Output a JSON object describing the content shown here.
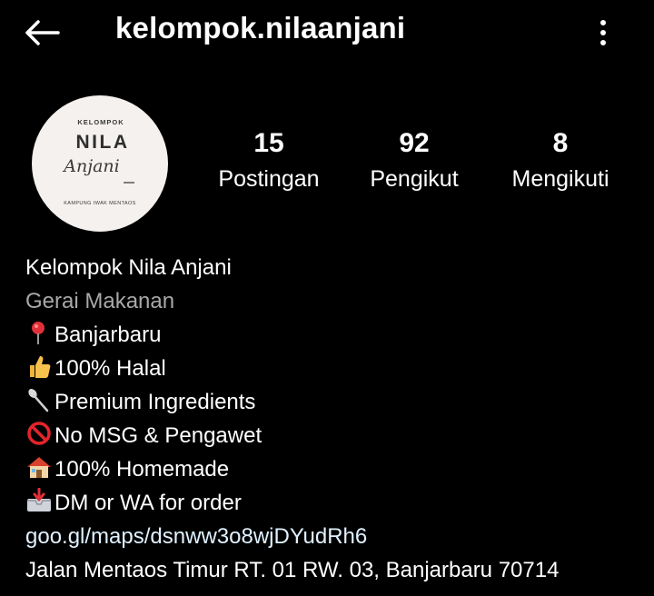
{
  "header": {
    "username": "kelompok.nilaanjani",
    "back_icon": "arrow-left-icon",
    "more_icon": "more-vertical-icon"
  },
  "avatar": {
    "logo_top": "KELOMPOK",
    "logo_main": "NILA",
    "logo_script": "Anjani",
    "logo_bottom": "KAMPUNG IWAK MENTAOS"
  },
  "stats": {
    "posts": {
      "value": "15",
      "label": "Postingan"
    },
    "followers": {
      "value": "92",
      "label": "Pengikut"
    },
    "following": {
      "value": "8",
      "label": "Mengikuti"
    }
  },
  "bio": {
    "name": "Kelompok Nila Anjani",
    "category": "Gerai Makanan",
    "lines": [
      {
        "icon": "pin-icon",
        "text": "Banjarbaru"
      },
      {
        "icon": "thumbs-up-icon",
        "text": "100% Halal"
      },
      {
        "icon": "spoon-icon",
        "text": "Premium Ingredients"
      },
      {
        "icon": "prohibited-icon",
        "text": "No MSG & Pengawet"
      },
      {
        "icon": "house-icon",
        "text": "100% Homemade"
      },
      {
        "icon": "inbox-tray-icon",
        "text": "DM or WA for order"
      }
    ],
    "link": "goo.gl/maps/dsnww3o8wjDYudRh6",
    "address": "Jalan Mentaos Timur RT. 01 RW. 03, Banjarbaru 70714"
  },
  "colors": {
    "background": "#000000",
    "text": "#ffffff",
    "secondary": "#a8a8a8",
    "link": "#e0f1ff"
  }
}
